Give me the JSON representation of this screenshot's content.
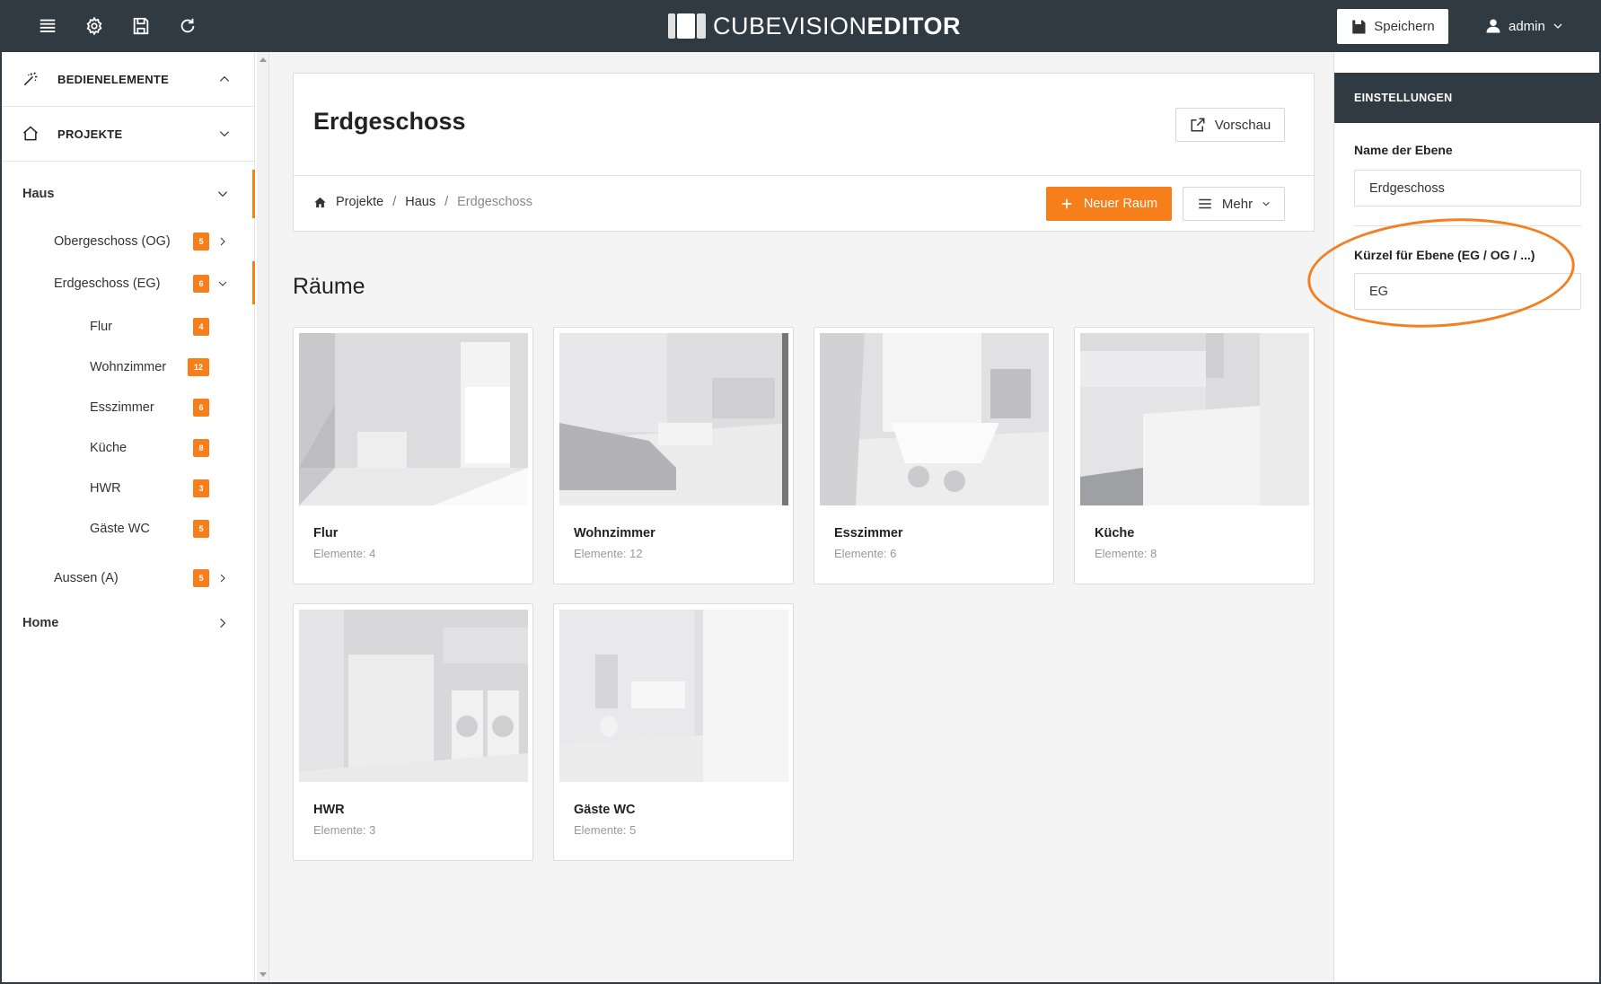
{
  "app": {
    "brand_light": "CUBEVISION",
    "brand_bold": "EDITOR",
    "accent_color": "#f67f1b",
    "topbar_color": "#2f3a43"
  },
  "topbar": {
    "icons": [
      "menu-icon",
      "gear-icon",
      "floppy-disk-icon",
      "refresh-icon"
    ],
    "save_label": "Speichern",
    "user_label": "admin"
  },
  "sidebar": {
    "sections": [
      {
        "label": "BEDIENELEMENTE",
        "icon": "magic-wand-icon",
        "expanded": true
      },
      {
        "label": "PROJEKTE",
        "icon": "home-icon",
        "expanded": false
      }
    ],
    "project": "Haus",
    "levels": [
      {
        "label": "Obergeschoss (OG)",
        "count": "5"
      },
      {
        "label": "Erdgeschoss (EG)",
        "count": "6"
      },
      {
        "label": "Aussen (A)",
        "count": "5"
      }
    ],
    "rooms": [
      {
        "label": "Flur",
        "count": "4"
      },
      {
        "label": "Wohnzimmer",
        "count": "12"
      },
      {
        "label": "Esszimmer",
        "count": "6"
      },
      {
        "label": "Küche",
        "count": "8"
      },
      {
        "label": "HWR",
        "count": "3"
      },
      {
        "label": "Gäste WC",
        "count": "5"
      }
    ],
    "home": "Home"
  },
  "main": {
    "title": "Erdgeschoss",
    "preview_label": "Vorschau",
    "breadcrumb": {
      "root": "Projekte",
      "mid": "Haus",
      "current": "Erdgeschoss",
      "sep": "/"
    },
    "new_room_label": "Neuer Raum",
    "more_label": "Mehr",
    "section_title": "Räume",
    "cards": [
      {
        "name": "Flur",
        "meta": "Elemente: 4"
      },
      {
        "name": "Wohnzimmer",
        "meta": "Elemente: 12"
      },
      {
        "name": "Esszimmer",
        "meta": "Elemente: 6"
      },
      {
        "name": "Küche",
        "meta": "Elemente: 8"
      },
      {
        "name": "HWR",
        "meta": "Elemente: 3"
      },
      {
        "name": "Gäste WC",
        "meta": "Elemente: 5"
      }
    ]
  },
  "settings": {
    "title": "EINSTELLUNGEN",
    "name_label": "Name der Ebene",
    "name_value": "Erdgeschoss",
    "short_label": "Kürzel für Ebene (EG / OG / ...)",
    "short_value": "EG",
    "highlight_color": "#f47f20"
  }
}
